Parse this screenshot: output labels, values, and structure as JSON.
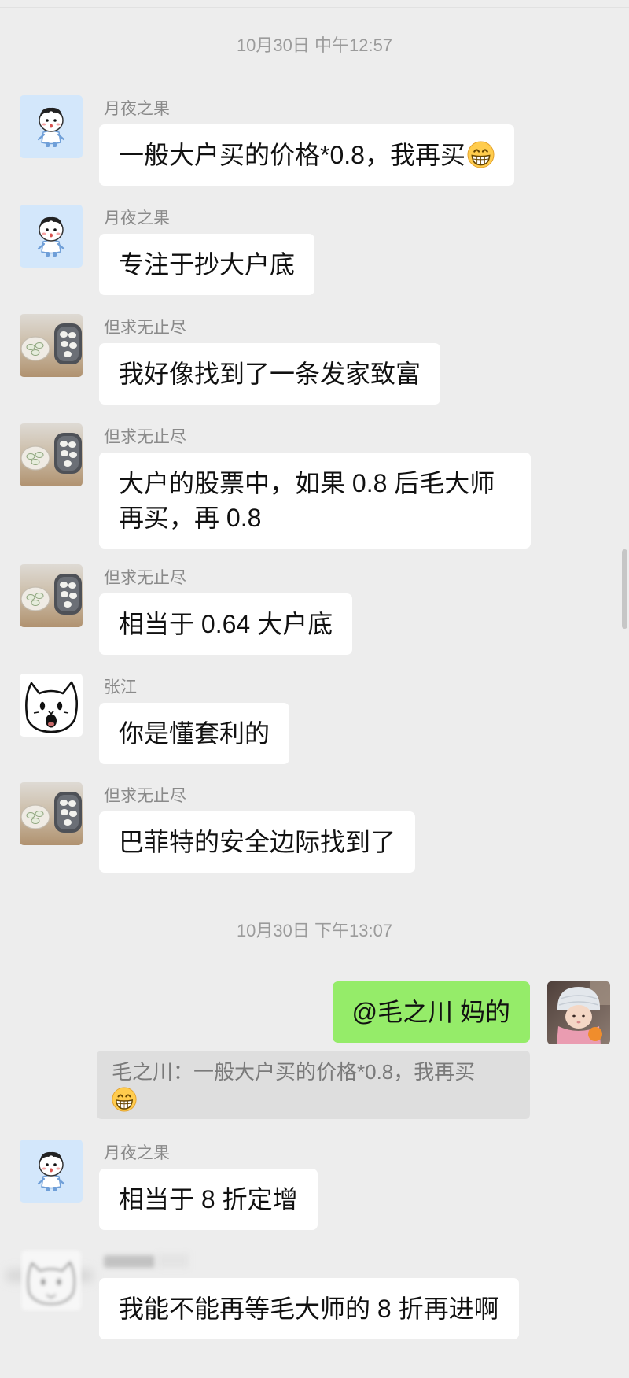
{
  "colors": {
    "page_background": "#ededed",
    "incoming_bubble": "#ffffff",
    "outgoing_bubble": "#95ec69",
    "quote_background": "#dedede",
    "timestamp_text": "#9b9b9b",
    "sender_name_text": "#8a8a8a",
    "message_text": "#111111"
  },
  "timestamps": [
    "10月30日 中午12:57",
    "10月30日 下午13:07"
  ],
  "messages": [
    {
      "sender": "月夜之果",
      "text": "一般大户买的价格*0.8，我再买",
      "trailing_emoji": "grinning-face-icon",
      "avatar": "cartoon-character-avatar"
    },
    {
      "sender": "月夜之果",
      "text": "专注于抄大户底",
      "avatar": "cartoon-character-avatar"
    },
    {
      "sender": "但求无止尽",
      "text": "我好像找到了一条发家致富",
      "avatar": "food-photo-avatar"
    },
    {
      "sender": "但求无止尽",
      "text": "大户的股票中，如果 0.8 后毛大师再买，再 0.8",
      "avatar": "food-photo-avatar"
    },
    {
      "sender": "但求无止尽",
      "text": "相当于 0.64 大户底",
      "avatar": "food-photo-avatar"
    },
    {
      "sender": "张江",
      "text": "你是懂套利的",
      "avatar": "cat-drawing-avatar"
    },
    {
      "sender": "但求无止尽",
      "text": "巴菲特的安全边际找到了",
      "avatar": "food-photo-avatar"
    },
    {
      "sender": "月夜之果",
      "text": "相当于 8 折定增",
      "avatar": "cartoon-character-avatar"
    },
    {
      "text": "我能不能再等毛大师的 8 折再进啊",
      "avatar": "blurred-avatar"
    }
  ],
  "outgoing": {
    "text": "@毛之川 妈的",
    "avatar": "baby-photo-avatar",
    "quote": {
      "text": "毛之川：一般大户买的价格*0.8，我再买",
      "trailing_emoji": "grinning-face-icon"
    }
  }
}
